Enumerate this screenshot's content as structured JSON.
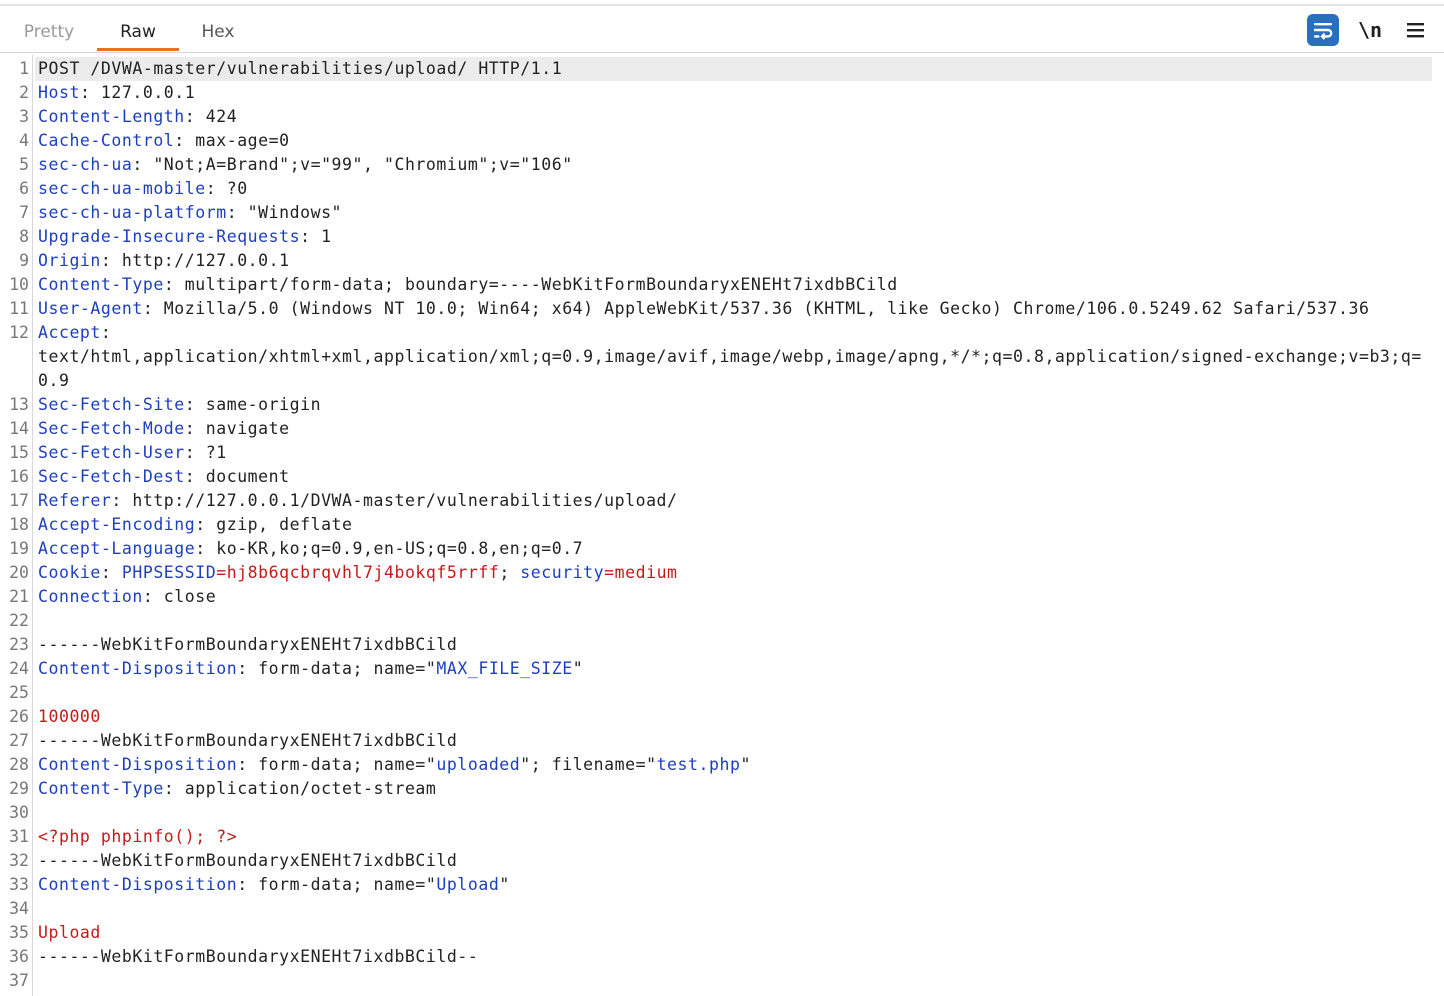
{
  "tabs": [
    {
      "label": "Pretty"
    },
    {
      "label": "Raw"
    },
    {
      "label": "Hex"
    }
  ],
  "toolbar": {
    "wrap_icon": "text-wrap-icon",
    "newline_label": "\\n",
    "menu_icon": "hamburger-menu-icon"
  },
  "colors": {
    "header_name": "#1e3fbd",
    "value_red": "#c41a1a",
    "accent_tab": "#e8702a",
    "wrap_button": "#2a6fbf"
  },
  "request": {
    "line_numbers": [
      "1",
      "2",
      "3",
      "4",
      "5",
      "6",
      "7",
      "8",
      "9",
      "10",
      "11",
      "12",
      "",
      "",
      "13",
      "14",
      "15",
      "16",
      "17",
      "18",
      "19",
      "20",
      "21",
      "22",
      "23",
      "24",
      "25",
      "26",
      "27",
      "28",
      "29",
      "30",
      "31",
      "32",
      "33",
      "34",
      "35",
      "36",
      "37"
    ],
    "lines": [
      [
        {
          "t": "POST /DVWA-master/vulnerabilities/upload/ HTTP/1.1",
          "c": ""
        }
      ],
      [
        {
          "t": "Host",
          "c": "k"
        },
        {
          "t": ": 127.0.0.1",
          "c": ""
        }
      ],
      [
        {
          "t": "Content-Length",
          "c": "k"
        },
        {
          "t": ": 424",
          "c": ""
        }
      ],
      [
        {
          "t": "Cache-Control",
          "c": "k"
        },
        {
          "t": ": max-age=0",
          "c": ""
        }
      ],
      [
        {
          "t": "sec-ch-ua",
          "c": "k"
        },
        {
          "t": ": \"Not;A=Brand\";v=\"99\", \"Chromium\";v=\"106\"",
          "c": ""
        }
      ],
      [
        {
          "t": "sec-ch-ua-mobile",
          "c": "k"
        },
        {
          "t": ": ?0",
          "c": ""
        }
      ],
      [
        {
          "t": "sec-ch-ua-platform",
          "c": "k"
        },
        {
          "t": ": \"Windows\"",
          "c": ""
        }
      ],
      [
        {
          "t": "Upgrade-Insecure-Requests",
          "c": "k"
        },
        {
          "t": ": 1",
          "c": ""
        }
      ],
      [
        {
          "t": "Origin",
          "c": "k"
        },
        {
          "t": ": http://127.0.0.1",
          "c": ""
        }
      ],
      [
        {
          "t": "Content-Type",
          "c": "k"
        },
        {
          "t": ": multipart/form-data; boundary=----WebKitFormBoundaryxENEHt7ixdbBCild",
          "c": ""
        }
      ],
      [
        {
          "t": "User-Agent",
          "c": "k"
        },
        {
          "t": ": Mozilla/5.0 (Windows NT 10.0; Win64; x64) AppleWebKit/537.36 (KHTML, like Gecko) Chrome/106.0.5249.62 Safari/537.36",
          "c": ""
        }
      ],
      [
        {
          "t": "Accept",
          "c": "k"
        },
        {
          "t": ":",
          "c": ""
        }
      ],
      [
        {
          "t": "text/html,application/xhtml+xml,application/xml;q=0.9,image/avif,image/webp,image/apng,*/*;q=0.8,application/signed-exchange;v=b3;q=",
          "c": ""
        }
      ],
      [
        {
          "t": "0.9",
          "c": ""
        }
      ],
      [
        {
          "t": "Sec-Fetch-Site",
          "c": "k"
        },
        {
          "t": ": same-origin",
          "c": ""
        }
      ],
      [
        {
          "t": "Sec-Fetch-Mode",
          "c": "k"
        },
        {
          "t": ": navigate",
          "c": ""
        }
      ],
      [
        {
          "t": "Sec-Fetch-User",
          "c": "k"
        },
        {
          "t": ": ?1",
          "c": ""
        }
      ],
      [
        {
          "t": "Sec-Fetch-Dest",
          "c": "k"
        },
        {
          "t": ": document",
          "c": ""
        }
      ],
      [
        {
          "t": "Referer",
          "c": "k"
        },
        {
          "t": ": http://127.0.0.1/DVWA-master/vulnerabilities/upload/",
          "c": ""
        }
      ],
      [
        {
          "t": "Accept-Encoding",
          "c": "k"
        },
        {
          "t": ": gzip, deflate",
          "c": ""
        }
      ],
      [
        {
          "t": "Accept-Language",
          "c": "k"
        },
        {
          "t": ": ko-KR,ko;q=0.9,en-US;q=0.8,en;q=0.7",
          "c": ""
        }
      ],
      [
        {
          "t": "Cookie",
          "c": "k"
        },
        {
          "t": ": ",
          "c": ""
        },
        {
          "t": "PHPSESSID",
          "c": "b"
        },
        {
          "t": "=hj8b6qcbrqvhl7j4bokqf5rrff",
          "c": "r"
        },
        {
          "t": "; ",
          "c": ""
        },
        {
          "t": "security",
          "c": "b"
        },
        {
          "t": "=medium",
          "c": "r"
        }
      ],
      [
        {
          "t": "Connection",
          "c": "k"
        },
        {
          "t": ": close",
          "c": ""
        }
      ],
      [],
      [
        {
          "t": "------WebKitFormBoundaryxENEHt7ixdbBCild",
          "c": ""
        }
      ],
      [
        {
          "t": "Content-Disposition",
          "c": "k"
        },
        {
          "t": ": form-data; name=\"",
          "c": ""
        },
        {
          "t": "MAX_FILE_SIZE",
          "c": "b"
        },
        {
          "t": "\"",
          "c": ""
        }
      ],
      [],
      [
        {
          "t": "100000",
          "c": "r"
        }
      ],
      [
        {
          "t": "------WebKitFormBoundaryxENEHt7ixdbBCild",
          "c": ""
        }
      ],
      [
        {
          "t": "Content-Disposition",
          "c": "k"
        },
        {
          "t": ": form-data; name=\"",
          "c": ""
        },
        {
          "t": "uploaded",
          "c": "b"
        },
        {
          "t": "\"; filename=\"",
          "c": ""
        },
        {
          "t": "test.php",
          "c": "b"
        },
        {
          "t": "\"",
          "c": ""
        }
      ],
      [
        {
          "t": "Content-Type",
          "c": "k"
        },
        {
          "t": ": application/octet-stream",
          "c": ""
        }
      ],
      [],
      [
        {
          "t": "<?php phpinfo(); ?>",
          "c": "r"
        }
      ],
      [
        {
          "t": "------WebKitFormBoundaryxENEHt7ixdbBCild",
          "c": ""
        }
      ],
      [
        {
          "t": "Content-Disposition",
          "c": "k"
        },
        {
          "t": ": form-data; name=\"",
          "c": ""
        },
        {
          "t": "Upload",
          "c": "b"
        },
        {
          "t": "\"",
          "c": ""
        }
      ],
      [],
      [
        {
          "t": "Upload",
          "c": "r"
        }
      ],
      [
        {
          "t": "------WebKitFormBoundaryxENEHt7ixdbBCild--",
          "c": ""
        }
      ],
      []
    ]
  }
}
